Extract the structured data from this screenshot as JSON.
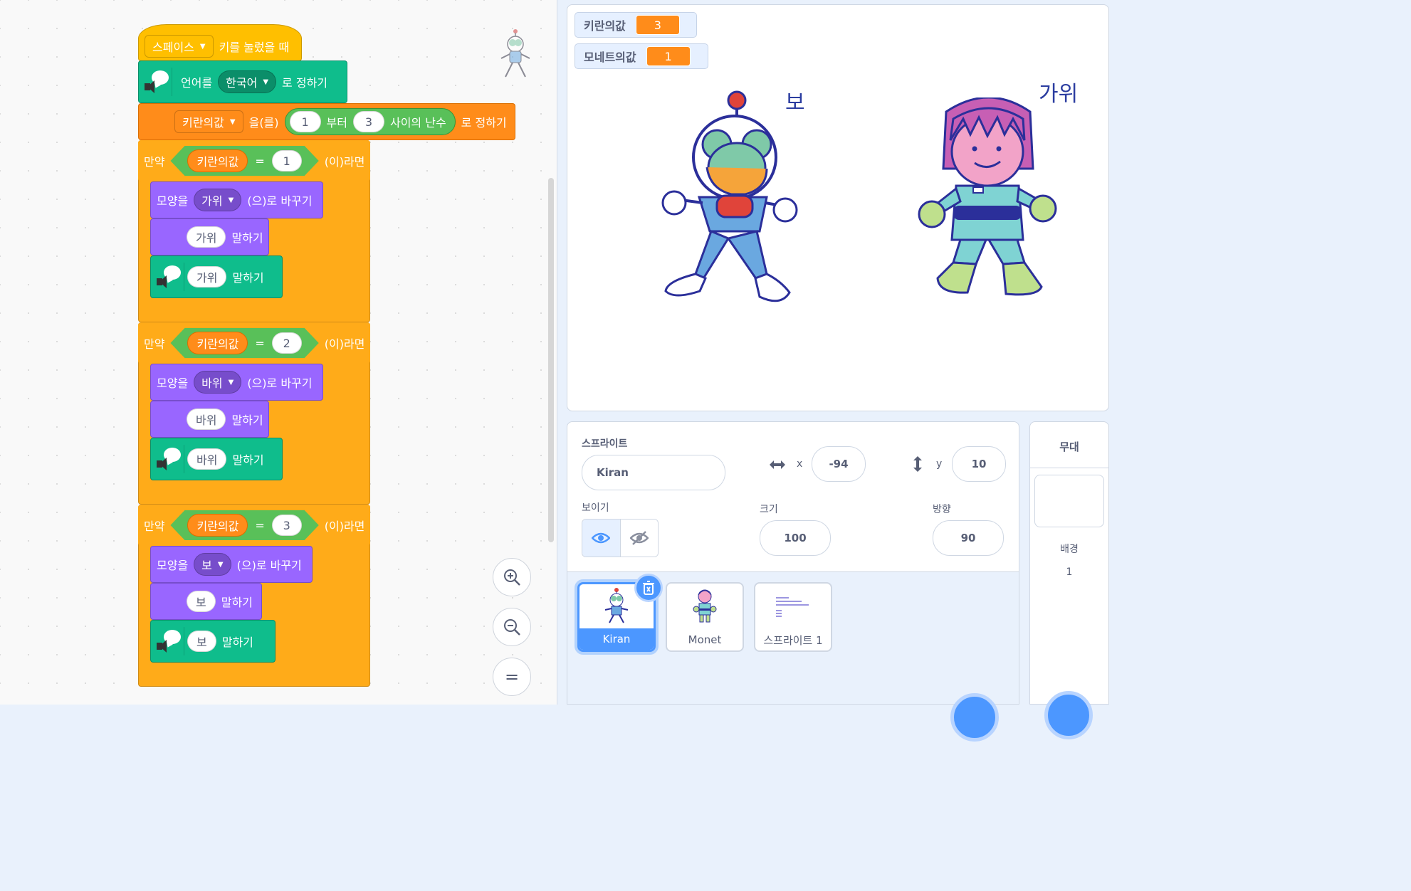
{
  "script": {
    "event": {
      "key": "스페이스",
      "text": "키를 눌렀을 때"
    },
    "language": {
      "label": "언어를",
      "value": "한국어",
      "suffix": "로 정하기"
    },
    "random": {
      "var": "키란의값",
      "text1": "을(를)",
      "from": "1",
      "text2": "부터",
      "to": "3",
      "text3": "사이의 난수",
      "text4": "로 정하기"
    },
    "ifs": [
      {
        "if_label": "만약",
        "var": "키란의값",
        "op": "=",
        "value": "1",
        "then": "(이)라면",
        "costume_label": "모양을",
        "costume": "가위",
        "costume_suffix": "(으)로 바꾸기",
        "say_value": "가위",
        "say_label": "말하기",
        "speak_value": "가위",
        "speak_label": "말하기"
      },
      {
        "if_label": "만약",
        "var": "키란의값",
        "op": "=",
        "value": "2",
        "then": "(이)라면",
        "costume_label": "모양을",
        "costume": "바위",
        "costume_suffix": "(으)로 바꾸기",
        "say_value": "바위",
        "say_label": "말하기",
        "speak_value": "바위",
        "speak_label": "말하기"
      },
      {
        "if_label": "만약",
        "var": "키란의값",
        "op": "=",
        "value": "3",
        "then": "(이)라면",
        "costume_label": "모양을",
        "costume": "보",
        "costume_suffix": "(으)로 바꾸기",
        "say_value": "보",
        "say_label": "말하기",
        "speak_value": "보",
        "speak_label": "말하기"
      }
    ]
  },
  "zoom": {
    "in": "+",
    "out": "−",
    "reset": "="
  },
  "stage": {
    "monitors": [
      {
        "name": "키란의값",
        "value": "3"
      },
      {
        "name": "모네트의값",
        "value": "1"
      }
    ],
    "kiran_label": "보",
    "monet_label": "가위"
  },
  "sprite_info": {
    "sprite_label": "스프라이트",
    "name": "Kiran",
    "x_label": "x",
    "x": "-94",
    "y_label": "y",
    "y": "10",
    "show_label": "보이기",
    "size_label": "크기",
    "size": "100",
    "direction_label": "방향",
    "direction": "90"
  },
  "sprites": [
    {
      "name": "Kiran",
      "selected": true
    },
    {
      "name": "Monet",
      "selected": false
    },
    {
      "name": "스프라이트 1",
      "selected": false
    }
  ],
  "stage_panel": {
    "title": "무대",
    "backdrop_label": "배경",
    "backdrop_count": "1"
  },
  "colors": {
    "events": "#ffbf00",
    "extension": "#0fbd8c",
    "variables": "#ff8c1a",
    "control": "#ffab19",
    "looks": "#9966ff",
    "operators": "#59c059",
    "accent": "#4c97ff"
  }
}
